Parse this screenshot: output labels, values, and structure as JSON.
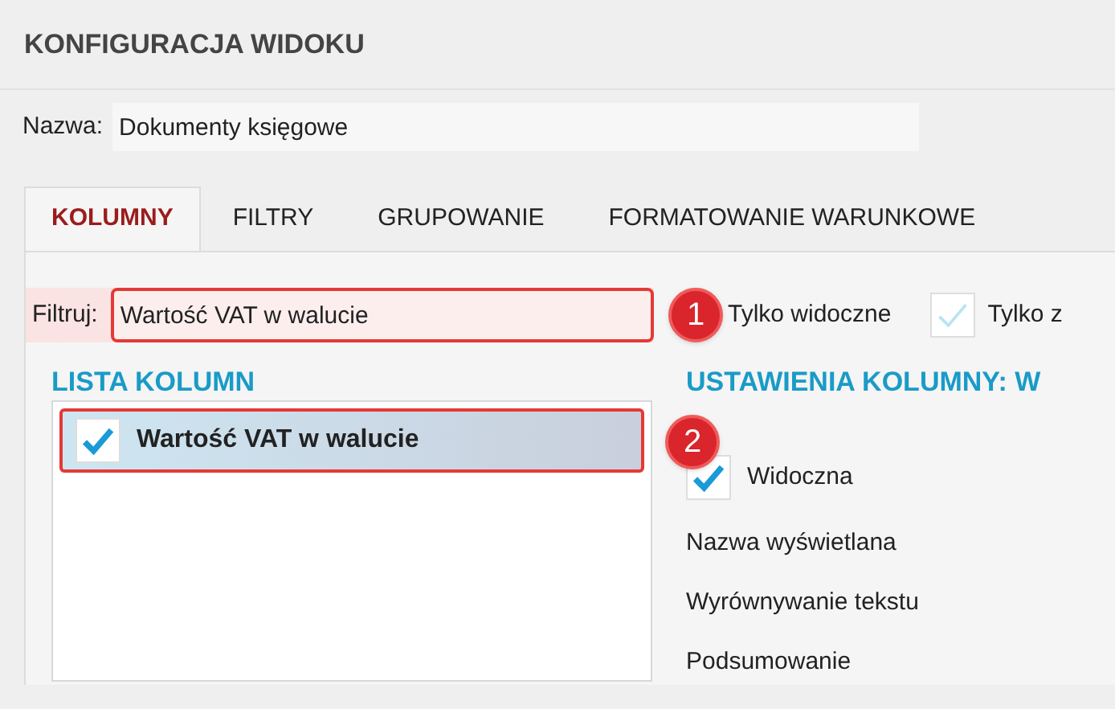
{
  "window": {
    "title": "KONFIGURACJA WIDOKU"
  },
  "name_field": {
    "label": "Nazwa:",
    "value": "Dokumenty księgowe"
  },
  "tabs": [
    {
      "label": "KOLUMNY",
      "selected": true
    },
    {
      "label": "FILTRY",
      "selected": false
    },
    {
      "label": "GRUPOWANIE",
      "selected": false
    },
    {
      "label": "FORMATOWANIE WARUNKOWE",
      "selected": false
    }
  ],
  "filter": {
    "label": "Filtruj:",
    "value": "Wartość VAT w walucie",
    "badge": "1"
  },
  "options": [
    {
      "label": "Tylko widoczne",
      "kind": "hidden"
    },
    {
      "label": "Tylko z",
      "kind": "checkbox",
      "checked": true
    }
  ],
  "column_list": {
    "heading": "LISTA KOLUMN",
    "items": [
      {
        "label": "Wartość VAT w walucie",
        "checked": true,
        "selected": true,
        "badge": "2"
      }
    ]
  },
  "column_settings": {
    "heading": "USTAWIENIA KOLUMNY: W",
    "visible": {
      "label": "Widoczna",
      "checked": true
    },
    "fields": [
      "Nazwa wyświetlana",
      "Wyrównywanie tekstu",
      "Podsumowanie"
    ]
  }
}
